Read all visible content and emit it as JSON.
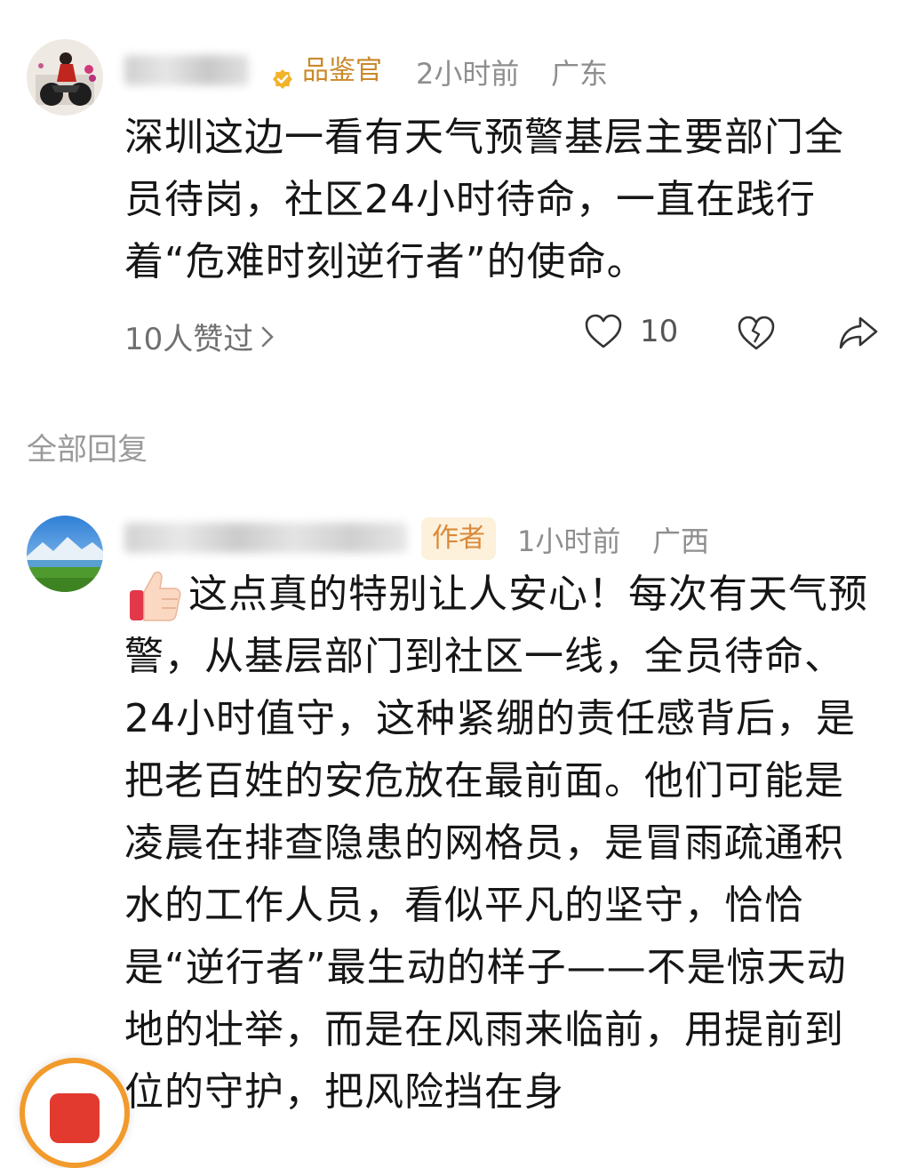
{
  "comment1": {
    "badge_label": "品鉴官",
    "time": "2小时前",
    "location": "广东",
    "text": "深圳这边一看有天气预警基层主要部门全员待岗，社区24小时待命，一直在践行着“危难时刻逆行者”的使命。",
    "likes_summary": "10人赞过",
    "like_count": "10"
  },
  "section": {
    "replies_title": "全部回复"
  },
  "reply1": {
    "badge_label": "作者",
    "time": "1小时前",
    "location": "广西",
    "text": "这点真的特别让人安心！每次有天气预警，从基层部门到社区一线，全员待命、24小时值守，这种紧绷的责任感背后，是把老百姓的安危放在最前面。他们可能是凌晨在排查隐患的网格员，是冒雨疏通积水的工作人员，看似平凡的坚守，恰恰是“逆行者”最生动的样子——不是惊天动地的壮举，而是在风雨来临前，用提前到位的守护，把风险挡在身",
    "emoji_icon": "thumbs-up-icon"
  },
  "colors": {
    "badge_bg": "#fdf1dc",
    "badge_text": "#c9892a",
    "author_text": "#d9893a",
    "meta_gray": "#8e8e8e"
  }
}
